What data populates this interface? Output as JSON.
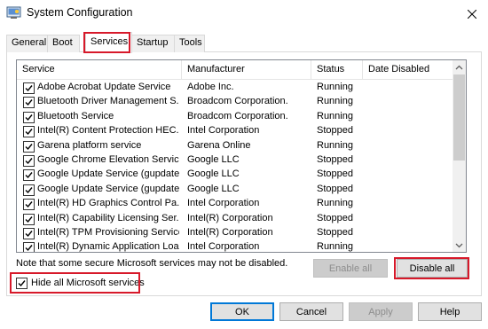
{
  "window": {
    "title": "System Configuration"
  },
  "tabs": [
    {
      "label": "General"
    },
    {
      "label": "Boot"
    },
    {
      "label": "Services"
    },
    {
      "label": "Startup"
    },
    {
      "label": "Tools"
    }
  ],
  "columns": {
    "service": "Service",
    "manufacturer": "Manufacturer",
    "status": "Status",
    "date_disabled": "Date Disabled"
  },
  "services": [
    {
      "name": "Adobe Acrobat Update Service",
      "manufacturer": "Adobe Inc.",
      "status": "Running",
      "date_disabled": "",
      "checked": true
    },
    {
      "name": "Bluetooth Driver Management S...",
      "manufacturer": "Broadcom Corporation.",
      "status": "Running",
      "date_disabled": "",
      "checked": true
    },
    {
      "name": "Bluetooth Service",
      "manufacturer": "Broadcom Corporation.",
      "status": "Running",
      "date_disabled": "",
      "checked": true
    },
    {
      "name": "Intel(R) Content Protection HEC...",
      "manufacturer": "Intel Corporation",
      "status": "Stopped",
      "date_disabled": "",
      "checked": true
    },
    {
      "name": "Garena platform service",
      "manufacturer": "Garena Online",
      "status": "Running",
      "date_disabled": "",
      "checked": true
    },
    {
      "name": "Google Chrome Elevation Servic...",
      "manufacturer": "Google LLC",
      "status": "Stopped",
      "date_disabled": "",
      "checked": true
    },
    {
      "name": "Google Update Service (gupdate)",
      "manufacturer": "Google LLC",
      "status": "Stopped",
      "date_disabled": "",
      "checked": true
    },
    {
      "name": "Google Update Service (gupdatem)",
      "manufacturer": "Google LLC",
      "status": "Stopped",
      "date_disabled": "",
      "checked": true
    },
    {
      "name": "Intel(R) HD Graphics Control Pa...",
      "manufacturer": "Intel Corporation",
      "status": "Running",
      "date_disabled": "",
      "checked": true
    },
    {
      "name": "Intel(R) Capability Licensing Ser...",
      "manufacturer": "Intel(R) Corporation",
      "status": "Stopped",
      "date_disabled": "",
      "checked": true
    },
    {
      "name": "Intel(R) TPM Provisioning Service",
      "manufacturer": "Intel(R) Corporation",
      "status": "Stopped",
      "date_disabled": "",
      "checked": true
    },
    {
      "name": "Intel(R) Dynamic Application Loa...",
      "manufacturer": "Intel Corporation",
      "status": "Running",
      "date_disabled": "",
      "checked": true
    }
  ],
  "note": "Note that some secure Microsoft services may not be disabled.",
  "hide_ms": {
    "label": "Hide all Microsoft services",
    "checked": true
  },
  "buttons": {
    "enable_all": "Enable all",
    "disable_all": "Disable all",
    "ok": "OK",
    "cancel": "Cancel",
    "apply": "Apply",
    "help": "Help"
  }
}
